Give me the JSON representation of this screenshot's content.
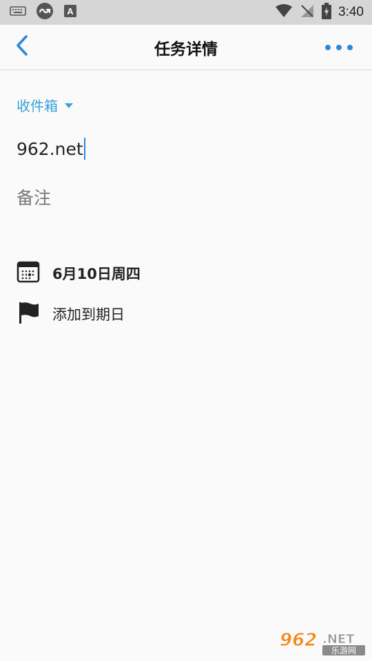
{
  "status_bar": {
    "time": "3:40",
    "icons": [
      "keyboard-icon",
      "app-loop-icon",
      "a-notification-icon",
      "wifi-icon",
      "no-signal-icon",
      "battery-icon"
    ]
  },
  "app_bar": {
    "title": "任务详情",
    "back_icon": "chevron-left-icon",
    "more_icon": "more-horizontal-icon",
    "accent_color": "#2a88d8"
  },
  "task": {
    "list_name": "收件箱",
    "title": "962.net",
    "note_placeholder": "备注",
    "reminder_label": "6月10日周四",
    "reminder_icon": "calendar-icon",
    "date_label": "添加到期日",
    "date_icon": "flag-icon",
    "list_color": "#34a3d8"
  },
  "watermark": {
    "brand": "962.NET",
    "sub": "乐游网"
  }
}
